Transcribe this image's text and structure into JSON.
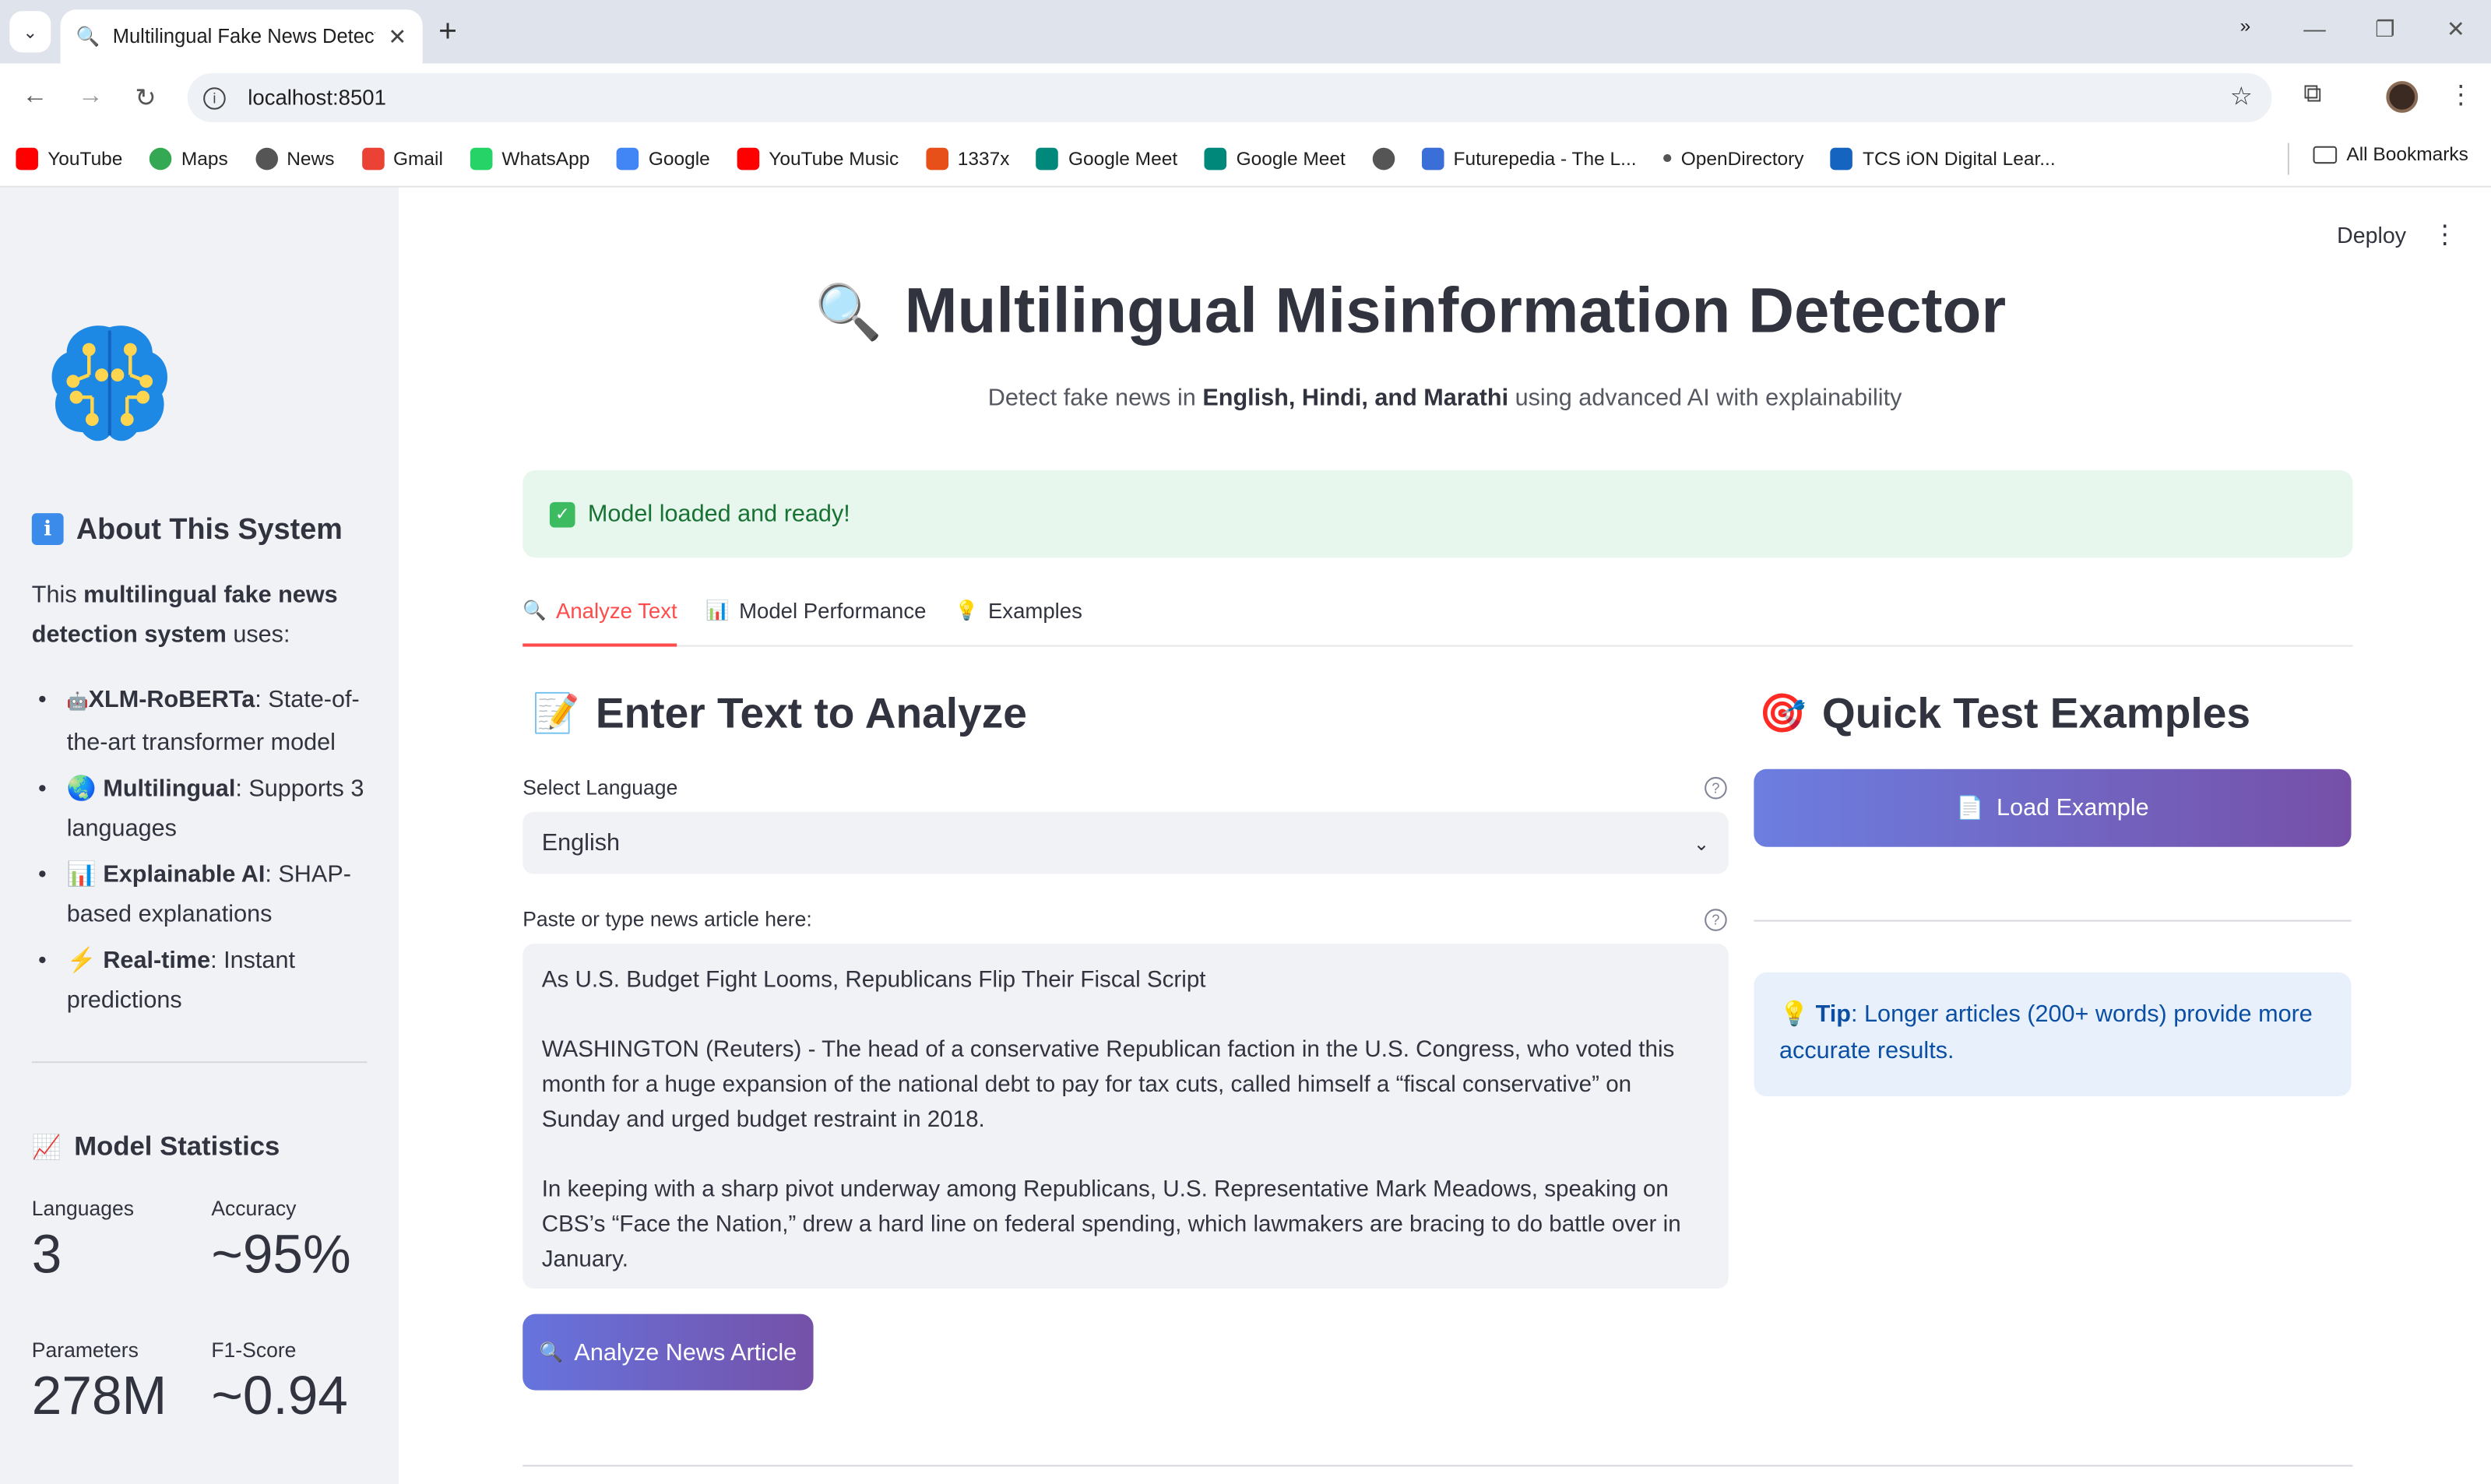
{
  "browser": {
    "tab_title": "Multilingual Fake News Detector",
    "url": "localhost:8501",
    "bookmarks": [
      {
        "label": "YouTube",
        "icon": "youtube-icon",
        "color": "#ff0000"
      },
      {
        "label": "Maps",
        "icon": "maps-icon",
        "color": "#34a853"
      },
      {
        "label": "News",
        "icon": "globe-icon",
        "color": "#555555"
      },
      {
        "label": "Gmail",
        "icon": "gmail-icon",
        "color": "#ea4335"
      },
      {
        "label": "WhatsApp",
        "icon": "whatsapp-icon",
        "color": "#25d366"
      },
      {
        "label": "Google",
        "icon": "google-icon",
        "color": "#4285f4"
      },
      {
        "label": "YouTube Music",
        "icon": "youtube-music-icon",
        "color": "#ff0000"
      },
      {
        "label": "1337x",
        "icon": "x-icon",
        "color": "#e8501a"
      },
      {
        "label": "Google Meet",
        "icon": "meet-icon",
        "color": "#00897b"
      },
      {
        "label": "Google Meet",
        "icon": "meet-icon",
        "color": "#00897b"
      },
      {
        "label": "",
        "icon": "globe-icon",
        "color": "#555555"
      },
      {
        "label": "Futurepedia - The L...",
        "icon": "futurepedia-icon",
        "color": "#3a6fd8"
      },
      {
        "label": "OpenDirectory",
        "icon": "dot-icon",
        "color": "#555555"
      },
      {
        "label": "TCS iON Digital Lear...",
        "icon": "power-icon",
        "color": "#1565c0"
      }
    ],
    "all_bookmarks": "All Bookmarks"
  },
  "sidebar": {
    "about_title": "About This System",
    "intro_prefix": "This ",
    "intro_bold": "multilingual fake news detection system",
    "intro_suffix": " uses:",
    "features": [
      {
        "icon": "🤖",
        "bold": "XLM-RoBERTa",
        "text": ": State-of-the-art transformer model"
      },
      {
        "icon": "🌏",
        "bold": "Multilingual",
        "text": ": Supports 3 languages"
      },
      {
        "icon": "📊",
        "bold": "Explainable AI",
        "text": ": SHAP-based explanations"
      },
      {
        "icon": "⚡",
        "bold": "Real-time",
        "text": ": Instant predictions"
      }
    ],
    "stats_title": "Model Statistics",
    "metrics": [
      {
        "label": "Languages",
        "value": "3"
      },
      {
        "label": "Accuracy",
        "value": "~95%"
      },
      {
        "label": "Parameters",
        "value": "278M"
      },
      {
        "label": "F1-Score",
        "value": "~0.94"
      }
    ]
  },
  "header": {
    "deploy": "Deploy",
    "title": "Multilingual Misinformation Detector",
    "subtitle_prefix": "Detect fake news in ",
    "subtitle_bold": "English, Hindi, and Marathi",
    "subtitle_suffix": " using advanced AI with explainability"
  },
  "status": {
    "message": "Model loaded and ready!"
  },
  "tabs": [
    {
      "icon": "🔍",
      "label": "Analyze Text"
    },
    {
      "icon": "📊",
      "label": "Model Performance"
    },
    {
      "icon": "💡",
      "label": "Examples"
    }
  ],
  "analyze": {
    "heading": "Enter Text to Analyze",
    "language_label": "Select Language",
    "language_value": "English",
    "text_label": "Paste or type news article here:",
    "text_value": "As U.S. Budget Fight Looms, Republicans Flip Their Fiscal Script\n\nWASHINGTON (Reuters) - The head of a conservative Republican faction in the U.S. Congress, who voted this month for a huge expansion of the national debt to pay for tax cuts, called himself a “fiscal conservative” on Sunday and urged budget restraint in 2018.\n\nIn keeping with a sharp pivot underway among Republicans, U.S. Representative Mark Meadows, speaking on CBS’s “Face the Nation,” drew a hard line on federal spending, which lawmakers are bracing to do battle over in January.",
    "button": "Analyze News Article"
  },
  "quick_test": {
    "heading": "Quick Test Examples",
    "button": "Load Example",
    "tip_bold": "Tip",
    "tip_text": ": Longer articles (200+ words) provide more accurate results."
  }
}
